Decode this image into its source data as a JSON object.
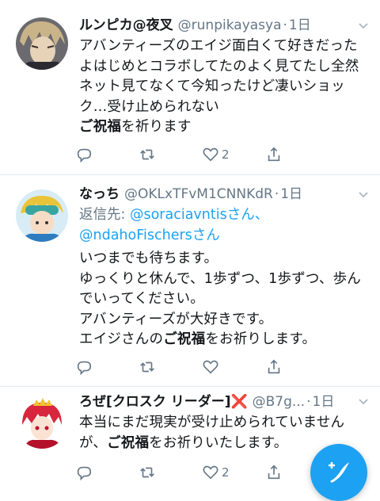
{
  "tweets": [
    {
      "name": "ルンピカ@夜叉",
      "handle": "@runpikayasya",
      "dot": "·",
      "time": "1日",
      "lines": [
        "アバンティーズのエイジ面白くて好きだった",
        "よはじめとコラボしてたのよく見てたし全然",
        "ネット見てなくて今知ったけど凄いショッ",
        "ク…受け止められない"
      ],
      "last_bold": "ご祝福",
      "last_rest": "を祈ります",
      "reply_count": "",
      "retweet_count": "",
      "like_count": "2"
    },
    {
      "name": "なっち",
      "handle": "@OKLxTFvM1CNNKdR",
      "dot": "·",
      "time": "1日",
      "reply_prefix": "返信先: ",
      "reply_to_1": "@soraciavntis",
      "reply_joiner_1": "さん、",
      "reply_to_2": "@ndahoFischers",
      "reply_joiner_2": "さん",
      "lines": [
        "いつまでも待ちます。",
        "ゆっくりと休んで、1歩ずつ、1歩ずつ、歩ん",
        "でいってください。",
        "アバンティーズが大好きです。"
      ],
      "last_pre": "エイジさんの",
      "last_bold": "ご祝福",
      "last_rest": "をお祈りします。",
      "reply_count": "",
      "retweet_count": "",
      "like_count": ""
    },
    {
      "name": "ろぜ[クロスク リーダー]",
      "name_mark": "❌",
      "handle": "@B7g...",
      "dot": "·",
      "time": "1日",
      "lines": [
        "本当にまだ現実が受け止められていません"
      ],
      "last_pre": "が、",
      "last_bold": "ご祝福",
      "last_rest": "をお祈りいたします。",
      "reply_count": "",
      "retweet_count": "",
      "like_count": "2"
    }
  ],
  "icons": {
    "reply": "reply-icon",
    "retweet": "retweet-icon",
    "like": "heart-icon",
    "share": "share-icon",
    "caret": "chevron-down-icon",
    "compose": "compose-icon"
  },
  "colors": {
    "accent": "#1da1f2",
    "muted": "#657786",
    "text": "#14171a",
    "divider": "#e1e8ed"
  }
}
